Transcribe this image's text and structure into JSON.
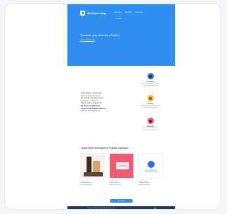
{
  "colors": {
    "primary": "#2f8ff0",
    "accent_yellow": "#ffd84d",
    "feature_blue": "#2f6fe0",
    "feature_yellow": "#f5c400",
    "feature_red": "#ef5b6b",
    "footer": "#1e3a5f"
  },
  "header": {
    "logo_text": "WebConsulting",
    "nav": [
      "Services",
      "Portfolio",
      "About Us"
    ],
    "nav_sub": "Contact"
  },
  "hero": {
    "title": "Transform your Idea into a Solution",
    "link": "Let's talk about it"
  },
  "intro": {
    "lines": [
      "Lorem ipsum consectetur",
      "dolor sit amet adipiscing",
      "elit sed do eiusmod tempor",
      "incididunt ut labore et",
      "dolore magna aliqua enim",
      "ad minim veniam quis",
      "nostrud exercitation ullamco",
      "laboris nisi ut aliquip ex."
    ]
  },
  "features": [
    {
      "icon": "clipboard-icon",
      "title": "Consulting",
      "desc": [
        "Lorem ipsum dolor sit amet",
        "consectetur adipiscing elit"
      ]
    },
    {
      "icon": "lightbulb-icon",
      "title": "Strategy",
      "desc": [
        "Sed do eiusmod tempor incididunt",
        "ut labore et dolore magna"
      ]
    },
    {
      "icon": "puzzle-icon",
      "title": "Solutions",
      "desc": [
        "Ut enim ad minim veniam",
        "quis nostrud exercitation"
      ]
    }
  ],
  "projects_section": {
    "title": "Latest Web Development Projects Deployed",
    "button": "View More"
  },
  "projects": [
    {
      "name": "Project One",
      "meta": [
        "Lorem ipsum dolor",
        "sit amet consectetur"
      ]
    },
    {
      "name": "Project Two",
      "meta": [
        "Lorem ipsum dolor",
        "sit amet consectetur"
      ]
    },
    {
      "name": "Project Three",
      "meta": [
        "Lorem ipsum dolor",
        "sit amet consectetur"
      ]
    }
  ],
  "footer": {
    "text": "Copyright © WebConsulting. All rights reserved."
  }
}
